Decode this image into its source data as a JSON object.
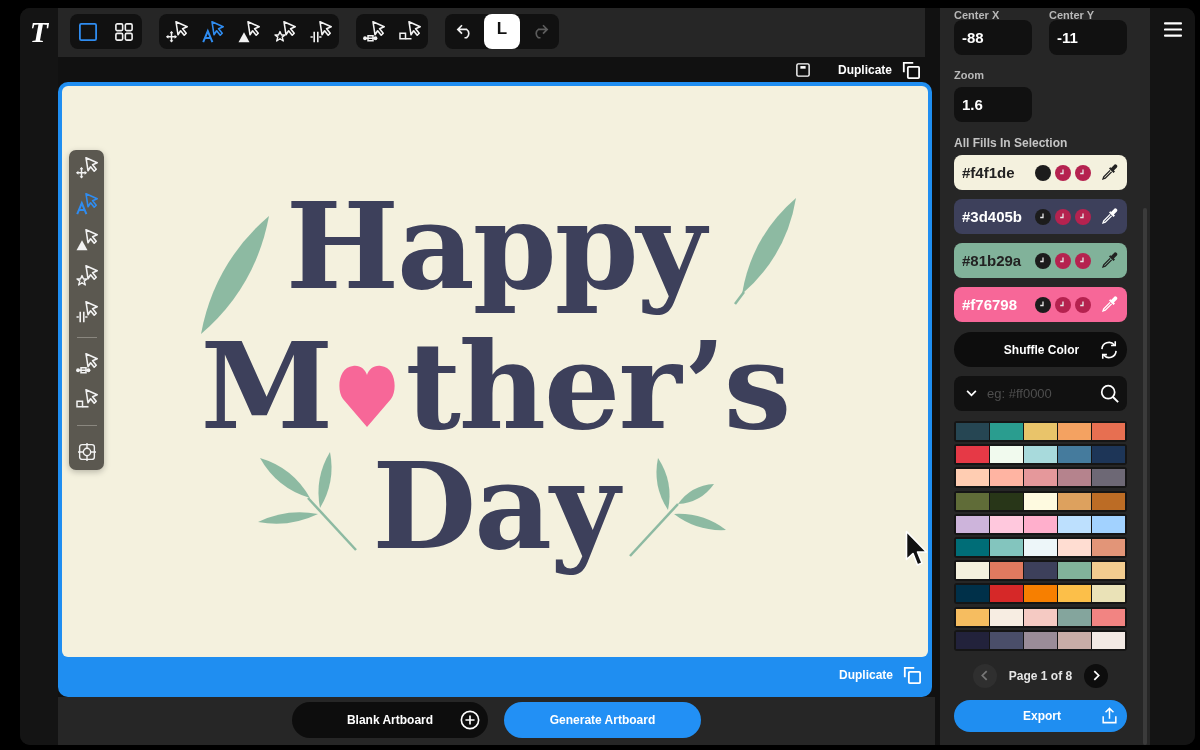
{
  "app": {
    "logo": "T"
  },
  "toolbar": {
    "groups": [
      {
        "items": [
          {
            "kind": "frame",
            "selected": true
          },
          {
            "kind": "grid",
            "selected": false
          }
        ]
      },
      {
        "items": [
          {
            "kind": "move",
            "selected": false
          },
          {
            "kind": "text",
            "selected": true
          },
          {
            "kind": "shape",
            "selected": false
          },
          {
            "kind": "star",
            "selected": false
          },
          {
            "kind": "split",
            "selected": false
          }
        ]
      },
      {
        "items": [
          {
            "kind": "nodes",
            "selected": false
          },
          {
            "kind": "node",
            "selected": false
          }
        ]
      },
      {
        "items": [
          {
            "kind": "undo",
            "selected": false,
            "disabled": false
          },
          {
            "kind": "toggle",
            "label": "L",
            "selected": true,
            "disabled": false
          },
          {
            "kind": "redo",
            "selected": false,
            "disabled": true
          }
        ]
      }
    ]
  },
  "canvas": {
    "previous_artboard": {
      "duplicate": "Duplicate"
    },
    "artboard": {
      "selected": true,
      "lettering": {
        "line_1": "Happy",
        "line_2_start": "M",
        "line_2_end": "ther’s",
        "line_3": "Day"
      },
      "duplicate": "Duplicate"
    },
    "side_tools": {
      "groups": [
        {
          "items": [
            {
              "kind": "move",
              "selected": false
            },
            {
              "kind": "text",
              "selected": true
            },
            {
              "kind": "shape",
              "selected": false
            },
            {
              "kind": "star",
              "selected": false
            },
            {
              "kind": "split",
              "selected": false
            }
          ]
        },
        {
          "items": [
            {
              "kind": "nodes",
              "selected": false
            },
            {
              "kind": "node",
              "selected": false
            }
          ]
        },
        {
          "items": [
            {
              "kind": "target",
              "selected": false
            }
          ]
        }
      ]
    }
  },
  "bottom_bar": {
    "buttons": [
      {
        "kind": "blank",
        "label": "Blank Artboard"
      },
      {
        "kind": "generate",
        "label": "Generate Artboard"
      }
    ]
  },
  "panel": {
    "center_x": {
      "label": "Center X",
      "value": "-88"
    },
    "center_y": {
      "label": "Center Y",
      "value": "-11"
    },
    "zoom": {
      "label": "Zoom",
      "value": "1.6"
    },
    "fills_title": "All Fills In Selection",
    "fills": [
      {
        "code": "#f4f1de",
        "color": "#f4f1de",
        "dots": [
          {
            "color": "#1c1c1c",
            "marked": false
          },
          {
            "color": "#b5224f",
            "marked": true
          },
          {
            "color": "#b5224f",
            "marked": true
          }
        ]
      },
      {
        "code": "#3d405b",
        "color": "#3d405b",
        "dots": [
          {
            "color": "#1c1c1c",
            "marked": true
          },
          {
            "color": "#b5224f",
            "marked": true
          },
          {
            "color": "#b5224f",
            "marked": true
          }
        ]
      },
      {
        "code": "#81b29a",
        "color": "#81b29a",
        "dots": [
          {
            "color": "#1c1c1c",
            "marked": true
          },
          {
            "color": "#b5224f",
            "marked": true
          },
          {
            "color": "#b5224f",
            "marked": true
          }
        ]
      },
      {
        "code": "#f76798",
        "color": "#f76798",
        "dots": [
          {
            "color": "#1c1c1c",
            "marked": true
          },
          {
            "color": "#b5224f",
            "marked": true
          },
          {
            "color": "#b5224f",
            "marked": true
          }
        ]
      }
    ],
    "shuffle": {
      "label": "Shuffle Color"
    },
    "search": {
      "placeholder": "eg: #ff0000"
    },
    "palettes": [
      {
        "swatches": [
          {
            "color": "#264653"
          },
          {
            "color": "#2a9d8f"
          },
          {
            "color": "#e9c46a"
          },
          {
            "color": "#f4a261"
          },
          {
            "color": "#e76f51"
          }
        ]
      },
      {
        "swatches": [
          {
            "color": "#e63946"
          },
          {
            "color": "#f1faee"
          },
          {
            "color": "#a8dadc"
          },
          {
            "color": "#457b9d"
          },
          {
            "color": "#1d3557"
          }
        ]
      },
      {
        "swatches": [
          {
            "color": "#ffcdb2"
          },
          {
            "color": "#ffb4a2"
          },
          {
            "color": "#e5989b"
          },
          {
            "color": "#b5838d"
          },
          {
            "color": "#6d6875"
          }
        ]
      },
      {
        "swatches": [
          {
            "color": "#606c38"
          },
          {
            "color": "#283618"
          },
          {
            "color": "#fefae0"
          },
          {
            "color": "#dda15e"
          },
          {
            "color": "#bc6c25"
          }
        ]
      },
      {
        "swatches": [
          {
            "color": "#cdb4db"
          },
          {
            "color": "#ffc8dd"
          },
          {
            "color": "#ffafcc"
          },
          {
            "color": "#bde0fe"
          },
          {
            "color": "#a2d2ff"
          }
        ]
      },
      {
        "swatches": [
          {
            "color": "#006d77"
          },
          {
            "color": "#83c5be"
          },
          {
            "color": "#edf6f9"
          },
          {
            "color": "#ffddd2"
          },
          {
            "color": "#e29578"
          }
        ]
      },
      {
        "swatches": [
          {
            "color": "#f4f1de"
          },
          {
            "color": "#e07a5f"
          },
          {
            "color": "#3d405b"
          },
          {
            "color": "#81b29a"
          },
          {
            "color": "#f2cc8f"
          }
        ]
      },
      {
        "swatches": [
          {
            "color": "#003049"
          },
          {
            "color": "#d62828"
          },
          {
            "color": "#f77f00"
          },
          {
            "color": "#fcbf49"
          },
          {
            "color": "#eae2b7"
          }
        ]
      },
      {
        "swatches": [
          {
            "color": "#f6bd60"
          },
          {
            "color": "#f7ede2"
          },
          {
            "color": "#f5cac3"
          },
          {
            "color": "#84a59d"
          },
          {
            "color": "#f28482"
          }
        ]
      },
      {
        "swatches": [
          {
            "color": "#22223b"
          },
          {
            "color": "#4a4e69"
          },
          {
            "color": "#9a8c98"
          },
          {
            "color": "#c9ada7"
          },
          {
            "color": "#f2e9e4"
          }
        ]
      }
    ],
    "pagination": {
      "label": "Page 1 of 8",
      "prev": {
        "disabled": true
      },
      "next": {
        "disabled": false
      }
    },
    "export": {
      "label": "Export"
    }
  }
}
